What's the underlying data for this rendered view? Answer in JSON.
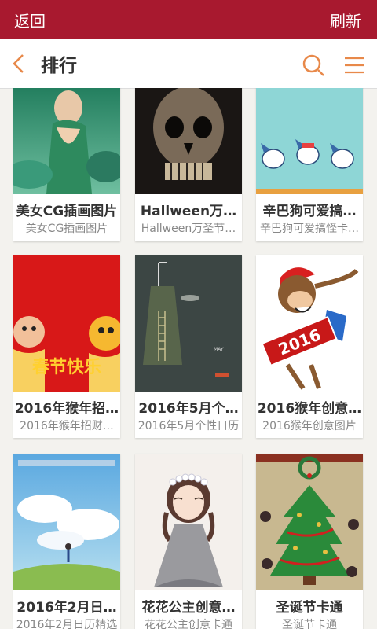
{
  "topbar": {
    "back_label": "返回",
    "refresh_label": "刷新"
  },
  "nav": {
    "title": "排行"
  },
  "cards": [
    {
      "title": "美女CG插画图片",
      "subtitle": "美女CG插画图片"
    },
    {
      "title": "Hallween万…",
      "subtitle": "Hallween万圣节…"
    },
    {
      "title": "辛巴狗可爱搞…",
      "subtitle": "辛巴狗可爱搞怪卡…"
    },
    {
      "title": "2016年猴年招…",
      "subtitle": "2016年猴年招财…"
    },
    {
      "title": "2016年5月个…",
      "subtitle": "2016年5月个性日历"
    },
    {
      "title": "2016猴年创意…",
      "subtitle": "2016猴年创意图片"
    },
    {
      "title": "2016年2月日…",
      "subtitle": "2016年2月日历精选"
    },
    {
      "title": "花花公主创意…",
      "subtitle": "花花公主创意卡通"
    },
    {
      "title": "圣诞节卡通",
      "subtitle": "圣诞节卡通"
    }
  ],
  "images": {
    "chunjie_text": "春节快乐",
    "monkey_year": "2016",
    "calendar_month": "MAY"
  },
  "colors": {
    "topbar": "#a8192f",
    "accent": "#e8894a",
    "background": "#f3f2ee"
  }
}
